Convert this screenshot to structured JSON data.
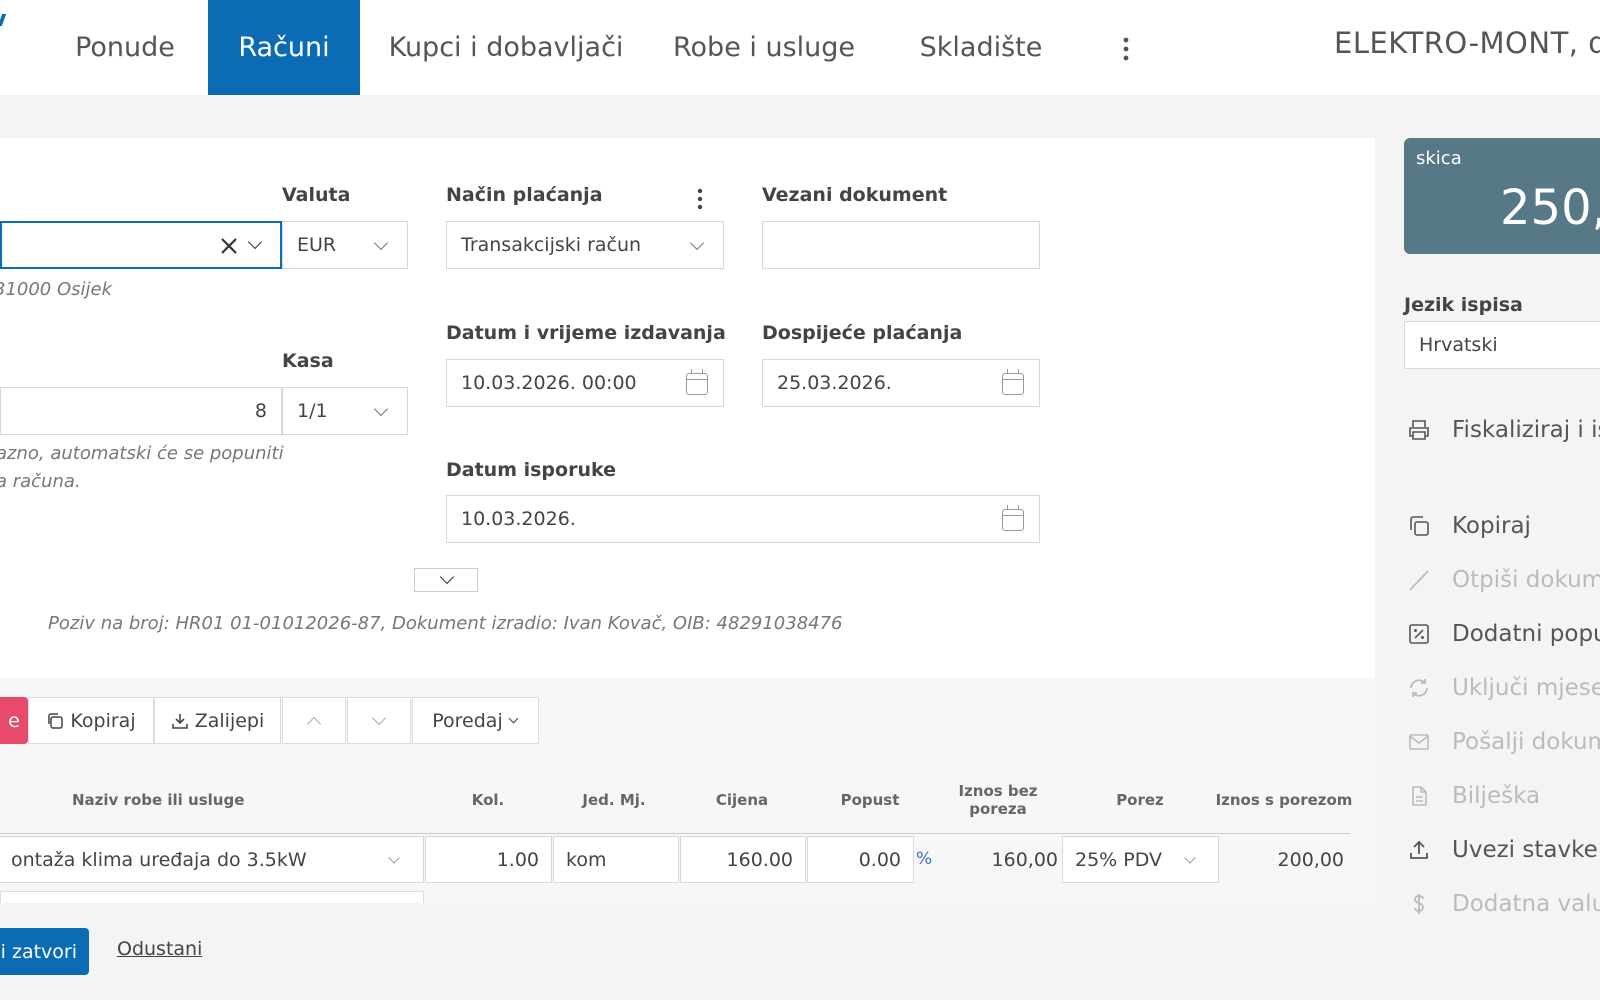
{
  "nav": {
    "tabs": [
      {
        "label": "Ponude"
      },
      {
        "label": "Računi"
      },
      {
        "label": "Kupci i dobavljači"
      },
      {
        "label": "Robe i usluge"
      },
      {
        "label": "Skladište"
      }
    ],
    "company": "ELEKTRO-MONT, d"
  },
  "form": {
    "customer": {
      "address_hint": "31000 Osijek"
    },
    "currency": {
      "label": "Valuta",
      "value": "EUR"
    },
    "payment_method": {
      "label": "Način plaćanja",
      "value": "Transakcijski račun"
    },
    "linked_document": {
      "label": "Vezani dokument",
      "value": ""
    },
    "issue_datetime": {
      "label": "Datum i vrijeme izdavanja",
      "value": "10.03.2026. 00:00"
    },
    "due_date": {
      "label": "Dospijeće plaćanja",
      "value": "25.03.2026."
    },
    "delivery_date": {
      "label": "Datum isporuke",
      "value": "10.03.2026."
    },
    "number": {
      "value": "8",
      "hint_line1": "azno, automatski će se popuniti",
      "hint_line2": "a računa."
    },
    "register": {
      "label": "Kasa",
      "value": "1/1"
    },
    "reference": "Poziv na broj: HR01 01-01012026-87, Dokument izradio: Ivan Kovač, OIB: 48291038476"
  },
  "toolbar": {
    "red_label": "e",
    "copy_label": "Kopiraj",
    "paste_label": "Zalijepi",
    "sort_label": "Poredaj"
  },
  "table": {
    "headers": {
      "name": "Naziv robe ili usluge",
      "qty": "Kol.",
      "unit": "Jed. Mj.",
      "price": "Cijena",
      "discount": "Popust",
      "net_line1": "Iznos bez",
      "net_line2": "poreza",
      "tax": "Porez",
      "gross": "Iznos s porezom"
    },
    "rows": [
      {
        "name": "ontaža klima uređaja do 3.5kW",
        "qty": "1.00",
        "unit": "kom",
        "price": "160.00",
        "discount": "0.00",
        "discount_unit": "%",
        "net": "160,00",
        "tax": "25% PDV",
        "gross": "200,00"
      }
    ]
  },
  "footer": {
    "save_label": "i zatvori",
    "cancel_label": "Odustani"
  },
  "side": {
    "status": "skica",
    "amount": "250,",
    "language": {
      "label": "Jezik ispisa",
      "value": "Hrvatski"
    },
    "actions": [
      {
        "label": "Fiskaliziraj i isp",
        "icon": "printer-icon"
      },
      {
        "label": "Kopiraj",
        "icon": "copy-icon"
      },
      {
        "label": "Otpiši dokume",
        "icon": "slash-icon"
      },
      {
        "label": "Dodatni popus",
        "icon": "discount-icon"
      },
      {
        "label": "Uključi mjeseč",
        "icon": "refresh-icon"
      },
      {
        "label": "Pošalji dokum",
        "icon": "mail-icon"
      },
      {
        "label": "Bilješka",
        "icon": "note-icon"
      },
      {
        "label": "Uvezi stavke",
        "icon": "upload-icon"
      },
      {
        "label": "Dodatna valut",
        "icon": "dollar-icon"
      }
    ]
  },
  "colors": {
    "brand": "#0b6bb5",
    "danger": "#e84a6a",
    "status_card": "#577887"
  }
}
